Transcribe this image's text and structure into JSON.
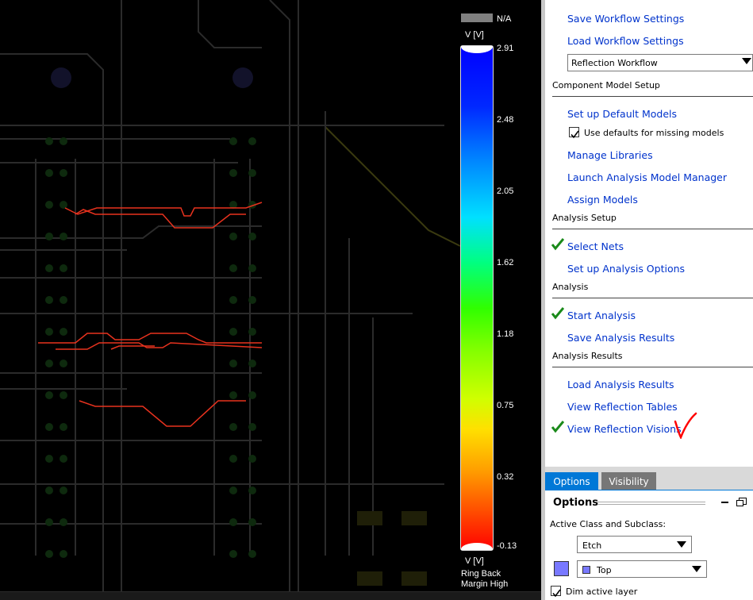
{
  "legend": {
    "na_label": "N/A",
    "unit_top": "V [V]",
    "unit_bottom": "V [V]",
    "ticks": [
      "2.91",
      "2.48",
      "2.05",
      "1.62",
      "1.18",
      "0.75",
      "0.32",
      "-0.13"
    ],
    "caption_line1": "Ring Back",
    "caption_line2": "Margin High",
    "colors": {
      "na": "#808080",
      "high": "#0000ff",
      "low": "#ff0000"
    }
  },
  "workflow": {
    "links_top": [
      "Save Workflow Settings",
      "Load Workflow Settings"
    ],
    "workflow_select": "Reflection Workflow",
    "sections": {
      "component_model_setup": "Component Model Setup",
      "analysis_setup": "Analysis Setup",
      "analysis": "Analysis",
      "analysis_results": "Analysis Results"
    },
    "component_links": {
      "setup_default_models": "Set up Default Models",
      "use_defaults_checkbox": "Use defaults for missing models",
      "manage_libraries": "Manage Libraries",
      "launch_manager": "Launch Analysis Model Manager",
      "assign_models": "Assign Models"
    },
    "analysis_setup_links": {
      "select_nets": "Select Nets",
      "setup_options": "Set up Analysis Options"
    },
    "analysis_links": {
      "start_analysis": "Start Analysis",
      "save_results": "Save Analysis Results"
    },
    "results_links": {
      "load_results": "Load Analysis Results",
      "view_tables": "View Reflection Tables",
      "view_visions": "View Reflection Visions"
    },
    "completed_steps": [
      "Select Nets",
      "Start Analysis",
      "View Reflection Visions"
    ],
    "check_color": "#1a8a1a",
    "annotation_color": "#ff0000"
  },
  "tabs": {
    "options": "Options",
    "visibility": "Visibility"
  },
  "options": {
    "title": "Options",
    "active_class_label": "Active Class and Subclass:",
    "class_value": "Etch",
    "subclass_value": "Top",
    "layer_color": "#7878ff",
    "dim_active_layer": "Dim active layer"
  }
}
